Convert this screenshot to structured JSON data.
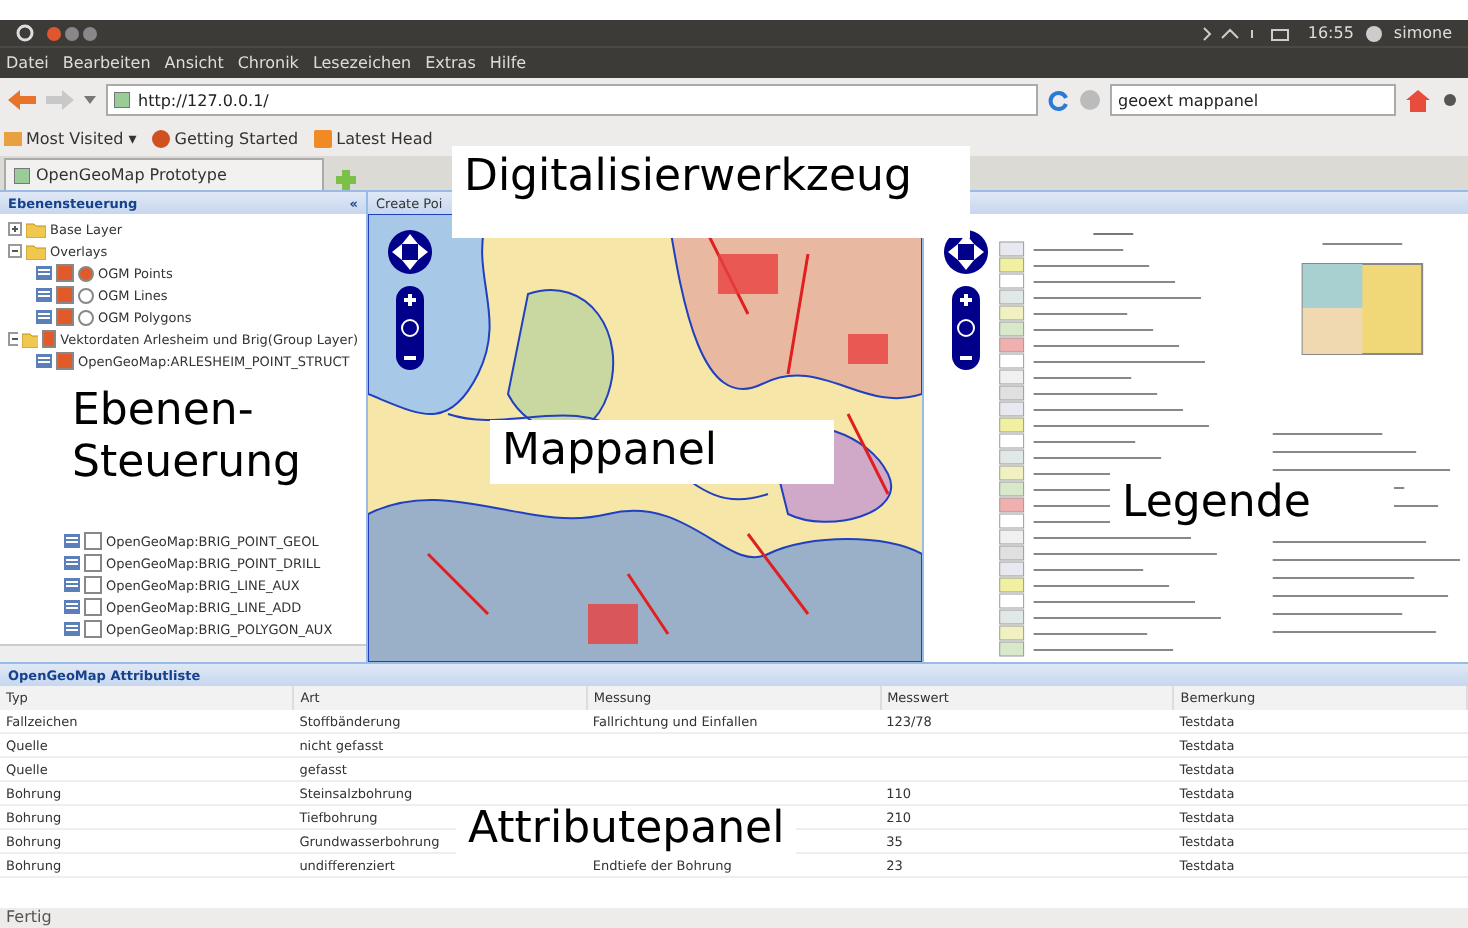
{
  "system_bar": {
    "time": "16:55",
    "user": "simone"
  },
  "menu": [
    "Datei",
    "Bearbeiten",
    "Ansicht",
    "Chronik",
    "Lesezeichen",
    "Extras",
    "Hilfe"
  ],
  "navigation": {
    "url": "http://127.0.0.1/",
    "search": "geoext mappanel"
  },
  "bookmarks": [
    {
      "label": "Most Visited ▾",
      "kind": "folder"
    },
    {
      "label": "Getting Started",
      "kind": "browser"
    },
    {
      "label": "Latest Head",
      "kind": "feed"
    }
  ],
  "tabs": [
    {
      "label": "OpenGeoMap Prototype",
      "selected": true
    }
  ],
  "layer_panel": {
    "title": "Ebenensteuerung",
    "collapse": "«",
    "tree": [
      {
        "label": "Base Layer",
        "kind": "folder",
        "expanded": false
      },
      {
        "label": "Overlays",
        "kind": "folder",
        "expanded": true,
        "children": [
          {
            "label": "OGM Points",
            "kind": "radio",
            "checked": true,
            "selected": true
          },
          {
            "label": "OGM Lines",
            "kind": "radio",
            "checked": true,
            "selected": false
          },
          {
            "label": "OGM Polygons",
            "kind": "radio",
            "checked": true,
            "selected": false
          }
        ]
      },
      {
        "label": "Vektordaten Arlesheim und Brig(Group Layer)",
        "kind": "folder",
        "expanded": true,
        "checked": true,
        "children": [
          {
            "label": "OpenGeoMap:ARLESHEIM_POINT_STRUCT",
            "kind": "layer",
            "checked": true
          }
        ]
      }
    ],
    "lower_layers": [
      {
        "label": "OpenGeoMap:BRIG_POINT_GEOL",
        "checked": false
      },
      {
        "label": "OpenGeoMap:BRIG_POINT_DRILL",
        "checked": false
      },
      {
        "label": "OpenGeoMap:BRIG_LINE_AUX",
        "checked": false
      },
      {
        "label": "OpenGeoMap:BRIG_LINE_ADD",
        "checked": false
      },
      {
        "label": "OpenGeoMap:BRIG_POLYGON_AUX",
        "checked": false
      }
    ]
  },
  "map_panel": {
    "toolbar": "Create Poi"
  },
  "attribute_panel": {
    "title": "OpenGeoMap Attributliste",
    "columns": [
      "Typ",
      "Art",
      "Messung",
      "Messwert",
      "Bemerkung"
    ],
    "rows": [
      [
        "Fallzeichen",
        "Stoffbänderung",
        "Fallrichtung und Einfallen",
        "123/78",
        "Testdata"
      ],
      [
        "Quelle",
        "nicht gefasst",
        "",
        "",
        "Testdata"
      ],
      [
        "Quelle",
        "gefasst",
        "",
        "",
        "Testdata"
      ],
      [
        "Bohrung",
        "Steinsalzbohrung",
        "",
        "110",
        "Testdata"
      ],
      [
        "Bohrung",
        "Tiefbohrung",
        "",
        "210",
        "Testdata"
      ],
      [
        "Bohrung",
        "Grundwasserbohrung",
        "",
        "35",
        "Testdata"
      ],
      [
        "Bohrung",
        "undifferenziert",
        "Endtiefe der Bohrung",
        "23",
        "Testdata"
      ]
    ]
  },
  "status_bar": "Fertig",
  "annotations": [
    {
      "label": "Digitalisierwerkzeug",
      "kind": "top"
    },
    {
      "label": "Ebenen-\nSteuerung",
      "kind": "left"
    },
    {
      "label": "Mappanel",
      "kind": "map"
    },
    {
      "label": "Legende",
      "kind": "legend"
    },
    {
      "label": "Attributepanel",
      "kind": "bottom"
    }
  ]
}
